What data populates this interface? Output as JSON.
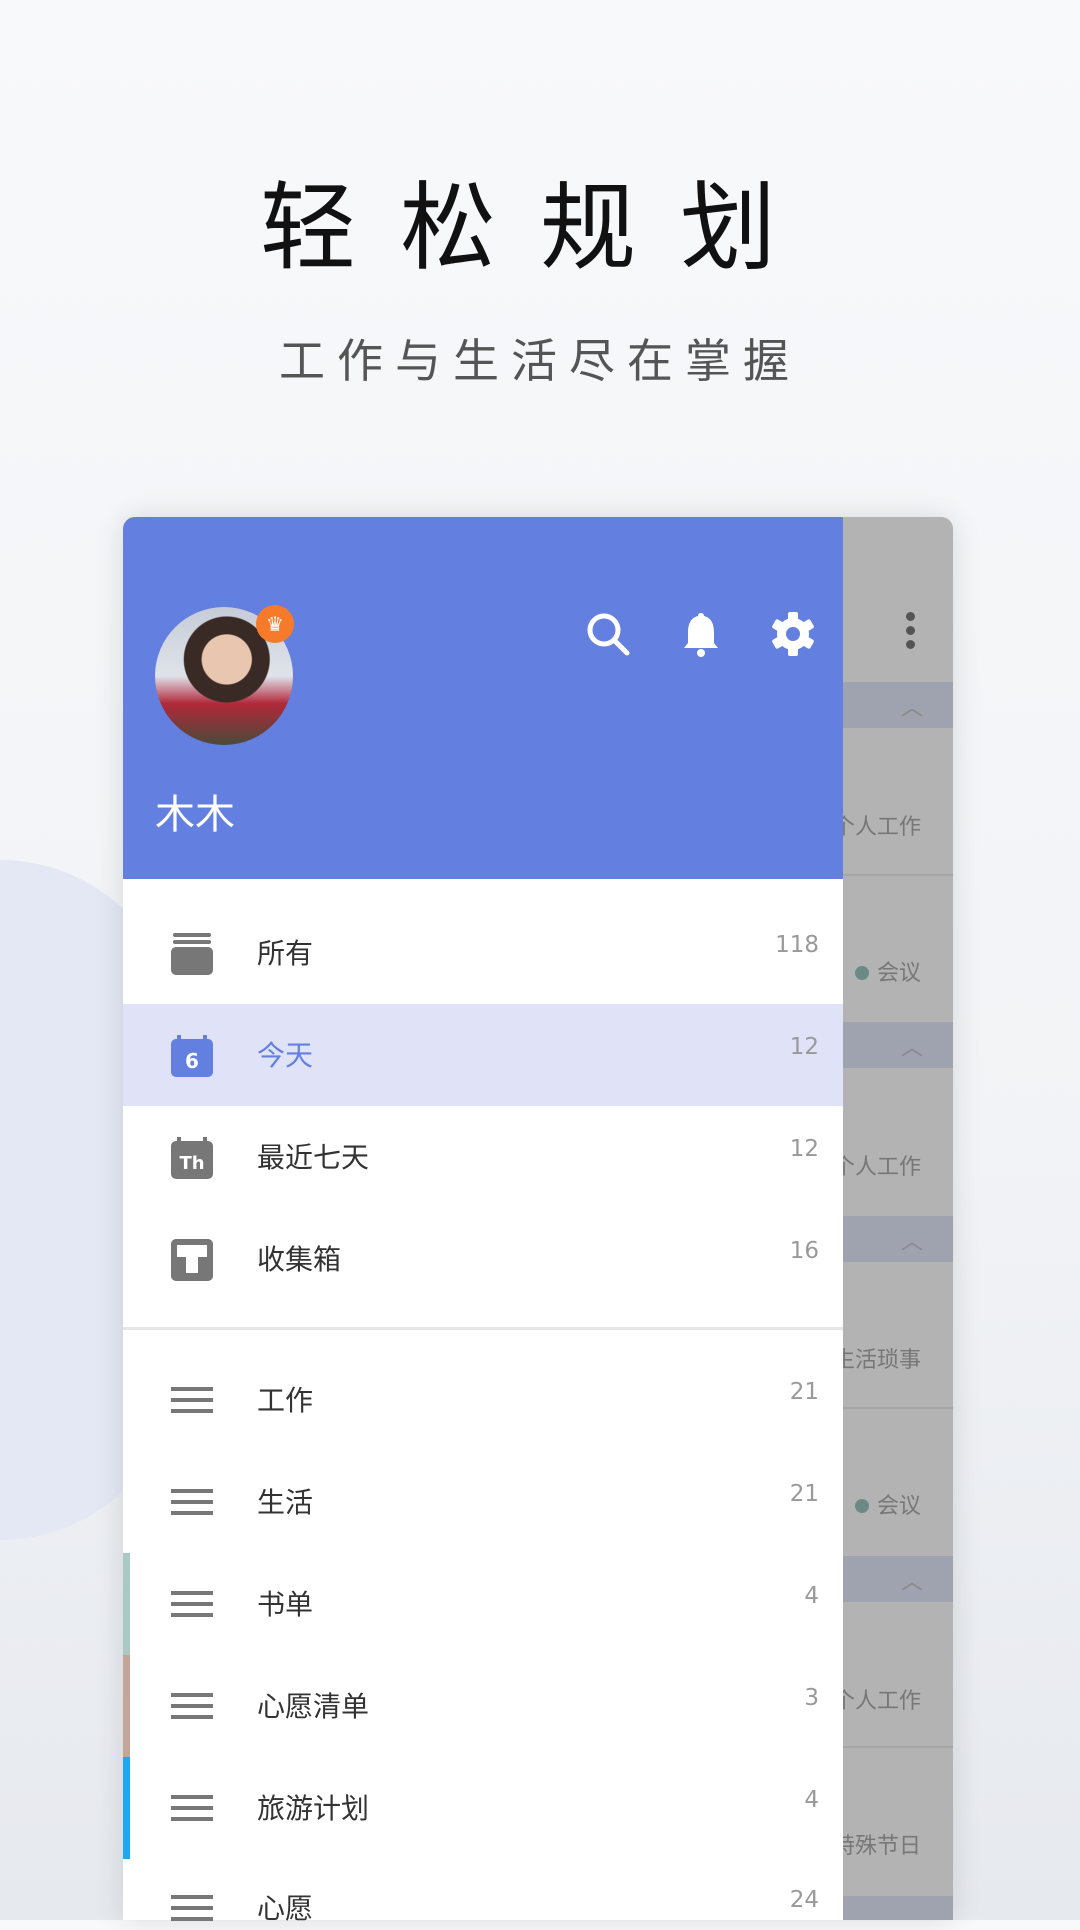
{
  "headline": "轻松规划",
  "subheadline": "工作与生活尽在掌握",
  "user": {
    "name": "木木",
    "badge": "crown-icon"
  },
  "header_icons": [
    "search-icon",
    "bell-icon",
    "gear-icon"
  ],
  "smart_lists": [
    {
      "label": "所有",
      "count": "118",
      "icon": "stack-icon"
    },
    {
      "label": "今天",
      "count": "12",
      "icon": "calendar-today-icon",
      "icon_text": "6",
      "active": true
    },
    {
      "label": "最近七天",
      "count": "12",
      "icon": "calendar-week-icon",
      "icon_text": "Th"
    },
    {
      "label": "收集箱",
      "count": "16",
      "icon": "inbox-icon"
    }
  ],
  "lists": [
    {
      "label": "工作",
      "count": "21"
    },
    {
      "label": "生活",
      "count": "21"
    },
    {
      "label": "书单",
      "count": "4",
      "color": "#a9c9c4"
    },
    {
      "label": "心愿清单",
      "count": "3",
      "color": "#c4a59a"
    },
    {
      "label": "旅游计划",
      "count": "4",
      "color": "#1ea8f0"
    },
    {
      "label": "心愿",
      "count": "24"
    }
  ],
  "background_tasks": [
    "个人工作",
    "会议",
    "个人工作",
    "生活琐事",
    "会议",
    "个人工作",
    "特殊节日"
  ],
  "colors": {
    "accent": "#637fdf",
    "active_bg": "#e0e3f8",
    "badge": "#f57b2a"
  }
}
